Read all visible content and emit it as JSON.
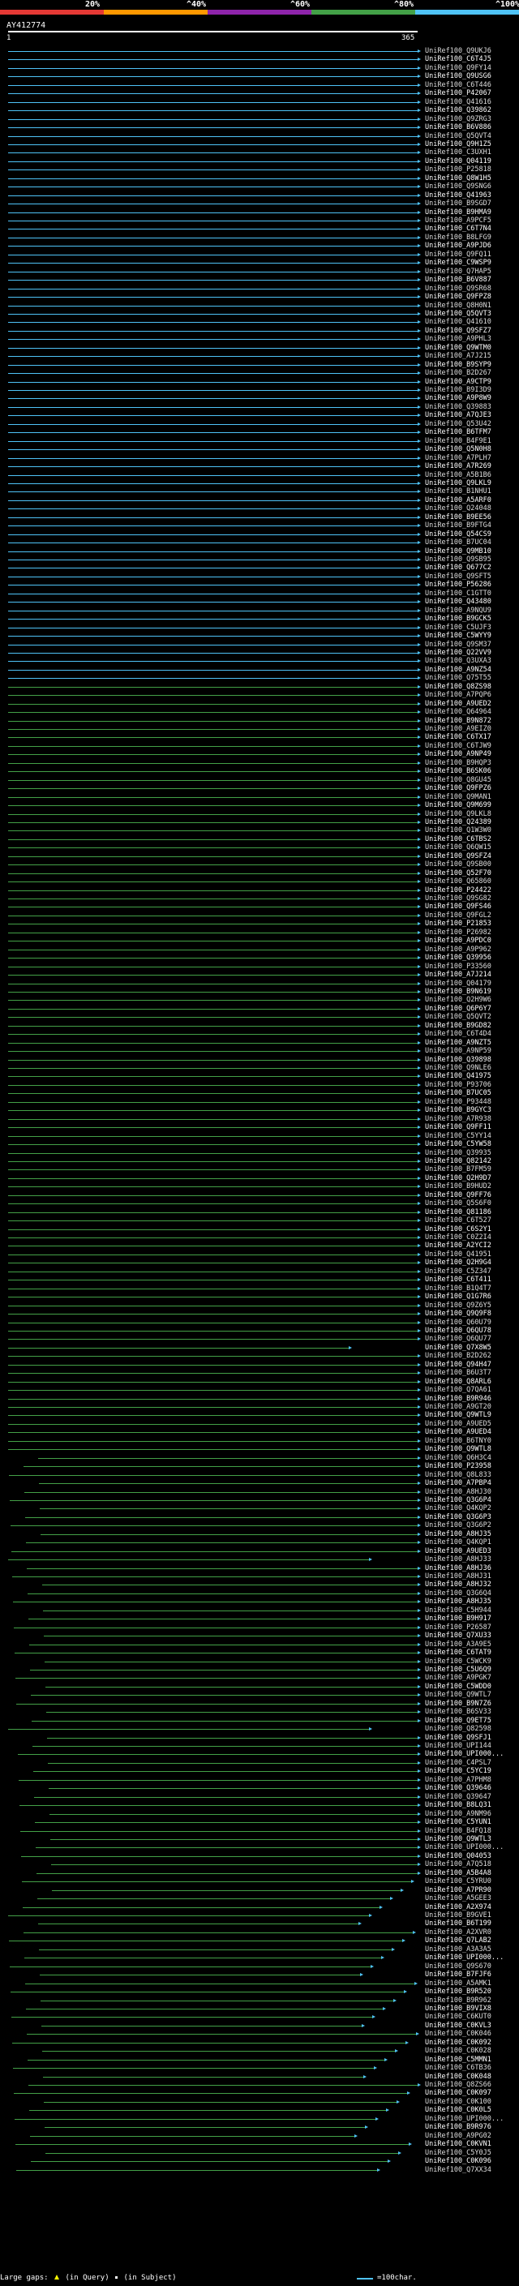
{
  "header": {
    "pct_labels": [
      "20%",
      "^40%",
      "^60%",
      "^80%",
      "^100%"
    ],
    "pct_colors": [
      "#e53935",
      "#ff9800",
      "#8e24aa",
      "#43a047",
      "#4fc3f7"
    ],
    "query_id": "AY412774",
    "scale_start": "1",
    "scale_end": "365"
  },
  "colors": {
    "cyan": "#4fc3f7",
    "green": "#43a047",
    "arrow": "#4fc3f7"
  },
  "hits": [
    "UniRef100_Q9UKJ6",
    "UniRef100_C6T4J5",
    "UniRef100_Q9FY14",
    "UniRef100_Q9USG6",
    "UniRef100_C6T446",
    "UniRef100_P42067",
    "UniRef100_Q41616",
    "UniRef100_Q39862",
    "UniRef100_Q9ZRG3",
    "UniRef100_B6V886",
    "UniRef100_Q5QVT4",
    "UniRef100_Q9H1Z5",
    "UniRef100_C3UXH1",
    "UniRef100_Q04119",
    "UniRef100_P25818",
    "UniRef100_Q8W1H5",
    "UniRef100_Q9SNG6",
    "UniRef100_Q41963",
    "UniRef100_B9SGD7",
    "UniRef100_B9HMA9",
    "UniRef100_A9PCF5",
    "UniRef100_C6T7N4",
    "UniRef100_B8LFG9",
    "UniRef100_A9PJD6",
    "UniRef100_Q9FQ11",
    "UniRef100_C9WSP9",
    "UniRef100_Q7HAP5",
    "UniRef100_B6V887",
    "UniRef100_Q9SR68",
    "UniRef100_Q9FPZ8",
    "UniRef100_Q8H0N1",
    "UniRef100_Q5QVT3",
    "UniRef100_Q41610",
    "UniRef100_Q9SFZ7",
    "UniRef100_A9PHL3",
    "UniRef100_Q9WTM0",
    "UniRef100_A7J215",
    "UniRef100_B9SYP9",
    "UniRef100_B2D267",
    "UniRef100_A9CTP9",
    "UniRef100_B9I3D9",
    "UniRef100_A9P8W9",
    "UniRef100_Q39883",
    "UniRef100_A7QJE3",
    "UniRef100_Q53U42",
    "UniRef100_B6TFM7",
    "UniRef100_B4F9E1",
    "UniRef100_Q5N0H8",
    "UniRef100_A7PLH7",
    "UniRef100_A7R269",
    "UniRef100_A5B1B6",
    "UniRef100_Q9LKL9",
    "UniRef100_B1NHU1",
    "UniRef100_A5ARF0",
    "UniRef100_Q24048",
    "UniRef100_B9EE56",
    "UniRef100_B9FTG4",
    "UniRef100_Q54CS9",
    "UniRef100_B7UC04",
    "UniRef100_Q9MB10",
    "UniRef100_Q9SB95",
    "UniRef100_Q677C2",
    "UniRef100_Q9SFT5",
    "UniRef100_P56286",
    "UniRef100_C1GTT0",
    "UniRef100_Q43480",
    "UniRef100_A9NQU9",
    "UniRef100_B9GCK5",
    "UniRef100_C5UJF3",
    "UniRef100_C5WYY9",
    "UniRef100_Q9SM37",
    "UniRef100_Q22VV9",
    "UniRef100_Q3UXA3",
    "UniRef100_A9NZ54",
    "UniRef100_Q75T55",
    "UniRef100_Q8ZS98",
    "UniRef100_A7PQP6",
    "UniRef100_A9UED2",
    "UniRef100_Q64964",
    "UniRef100_B9N872",
    "UniRef100_A9EIZ0",
    "UniRef100_C6TX17",
    "UniRef100_C6TJW9",
    "UniRef100_A9NP49",
    "UniRef100_B9HQP3",
    "UniRef100_B6SK06",
    "UniRef100_Q8GU45",
    "UniRef100_Q9FPZ6",
    "UniRef100_Q9MAN1",
    "UniRef100_Q9M699",
    "UniRef100_Q9LKL8",
    "UniRef100_Q24389",
    "UniRef100_Q1W3W0",
    "UniRef100_C6TBS2",
    "UniRef100_Q6QW15",
    "UniRef100_Q9SFZ4",
    "UniRef100_Q9SB00",
    "UniRef100_Q52F70",
    "UniRef100_Q65860",
    "UniRef100_P24422",
    "UniRef100_Q9SG82",
    "UniRef100_Q9FS46",
    "UniRef100_Q9FGL2",
    "UniRef100_P21853",
    "UniRef100_P26982",
    "UniRef100_A9PDC0",
    "UniRef100_A9P962",
    "UniRef100_Q39956",
    "UniRef100_P33560",
    "UniRef100_A7J214",
    "UniRef100_Q04179",
    "UniRef100_B9N619",
    "UniRef100_Q2H9W6",
    "UniRef100_Q6P6Y7",
    "UniRef100_Q5QVT2",
    "UniRef100_B9GD82",
    "UniRef100_C6T4D4",
    "UniRef100_A9NZT5",
    "UniRef100_A9NP59",
    "UniRef100_Q39898",
    "UniRef100_Q9NLE6",
    "UniRef100_Q41975",
    "UniRef100_P93706",
    "UniRef100_B7UC05",
    "UniRef100_P93448",
    "UniRef100_B9GYC3",
    "UniRef100_A7R938",
    "UniRef100_Q9FF11",
    "UniRef100_C5YY14",
    "UniRef100_C5YW58",
    "UniRef100_Q39935",
    "UniRef100_Q82142",
    "UniRef100_B7FM59",
    "UniRef100_Q2H9D7",
    "UniRef100_B9HUD2",
    "UniRef100_Q9FF76",
    "UniRef100_Q5S6F0",
    "UniRef100_Q81186",
    "UniRef100_C6T527",
    "UniRef100_C6S2Y1",
    "UniRef100_C0Z2I4",
    "UniRef100_A2YCI2",
    "UniRef100_Q41951",
    "UniRef100_Q2H9G4",
    "UniRef100_C5Z347",
    "UniRef100_C6T411",
    "UniRef100_B1Q4T7",
    "UniRef100_Q1G7R6",
    "UniRef100_Q9Z6Y5",
    "UniRef100_Q9Q9F8",
    "UniRef100_Q60U79",
    "UniRef100_Q6QU78",
    "UniRef100_Q6QU77",
    "UniRef100_Q7X8W5",
    "UniRef100_B2D262",
    "UniRef100_Q94H47",
    "UniRef100_B6U3T7",
    "UniRef100_Q8ARL6",
    "UniRef100_Q7QA61",
    "UniRef100_B9R946",
    "UniRef100_A9GT20",
    "UniRef100_Q9WTL9",
    "UniRef100_A9UED5",
    "UniRef100_A9UED4",
    "UniRef100_B6TNY0",
    "UniRef100_Q9WTL8",
    "UniRef100_Q6H3C4",
    "UniRef100_P23958",
    "UniRef100_Q8L833",
    "UniRef100_A7PBP4",
    "UniRef100_A8HJ30",
    "UniRef100_Q3G6P4",
    "UniRef100_Q4KQP2",
    "UniRef100_Q3G6P3",
    "UniRef100_Q3G6P2",
    "UniRef100_A8HJ35",
    "UniRef100_Q4KQP1",
    "UniRef100_A9UED3",
    "UniRef100_A8HJ33",
    "UniRef100_A8HJ36",
    "UniRef100_A8HJ31",
    "UniRef100_A8HJ32",
    "UniRef100_Q3G6Q4",
    "UniRef100_A8HJ35",
    "UniRef100_C5H944",
    "UniRef100_B9H917",
    "UniRef100_P26587",
    "UniRef100_Q7XU33",
    "UniRef100_A3A9E5",
    "UniRef100_C6TAT9",
    "UniRef100_C5WCK9",
    "UniRef100_C5U6Q9",
    "UniRef100_A9PGK7",
    "UniRef100_C5WDD0",
    "UniRef100_Q9WTL7",
    "UniRef100_B9N7Z6",
    "UniRef100_B6SV33",
    "UniRef100_Q9ET75",
    "UniRef100_Q82598",
    "UniRef100_Q9SFJ1",
    "UniRef100_UPI144",
    "UniRef100_UPI000...",
    "UniRef100_C4PSL7",
    "UniRef100_C5YC19",
    "UniRef100_A7PHM8",
    "UniRef100_Q39646",
    "UniRef100_Q39647",
    "UniRef100_B8LQ31",
    "UniRef100_A9NM96",
    "UniRef100_C5YUN1",
    "UniRef100_B4FQ18",
    "UniRef100_Q9WTL3",
    "UniRef100_UPI000...",
    "UniRef100_Q04053",
    "UniRef100_A7Q518",
    "UniRef100_A5B4A8",
    "UniRef100_C5YRU0",
    "UniRef100_A7PR90",
    "UniRef100_A5GEE3",
    "UniRef100_A2X974",
    "UniRef100_B9GVE1",
    "UniRef100_B6T199",
    "UniRef100_A2XVR0",
    "UniRef100_Q7LAB2",
    "UniRef100_A3A3A5",
    "UniRef100_UPI000...",
    "UniRef100_Q9S670",
    "UniRef100_B7FJF6",
    "UniRef100_A5AMK1",
    "UniRef100_B9R520",
    "UniRef100_B9R962",
    "UniRef100_B9VIX8",
    "UniRef100_C6KUT0",
    "UniRef100_C0KVL3",
    "UniRef100_C0K046",
    "UniRef100_C0K092",
    "UniRef100_C0K028",
    "UniRef100_C5MMN1",
    "UniRef100_C6TB36",
    "UniRef100_C0K048",
    "UniRef100_Q8ZS66",
    "UniRef100_C0K097",
    "UniRef100_C0K100",
    "UniRef100_C0K0L5",
    "UniRef100_UPI000...",
    "UniRef100_B9R976",
    "UniRef100_A9PG02",
    "UniRef100_C0KVN1",
    "UniRef100_C5Y0J5",
    "UniRef100_C0K096",
    "UniRef100_Q7XX34"
  ],
  "footer": {
    "gaps_label": "Large gaps:",
    "query_gap_label": "(in Query)",
    "subject_gap_label": "(in Subject)",
    "legend_label": "=100char."
  }
}
